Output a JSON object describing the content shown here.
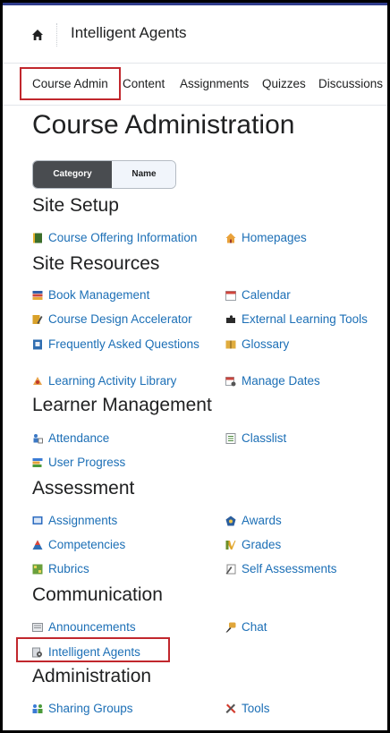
{
  "header": {
    "course_title": "Intelligent Agents",
    "home_icon": "home-icon"
  },
  "nav": [
    {
      "label": "Course Admin",
      "selected": true
    },
    {
      "label": "Content"
    },
    {
      "label": "Assignments"
    },
    {
      "label": "Quizzes"
    },
    {
      "label": "Discussions"
    }
  ],
  "page_title": "Course Administration",
  "view_toggle": {
    "category": "Category",
    "name": "Name",
    "selected": "Category"
  },
  "sections": [
    {
      "title": "Site Setup",
      "links": [
        {
          "label": "Course Offering Information",
          "icon": "book-icon"
        },
        {
          "label": "Homepages",
          "icon": "house-icon"
        }
      ]
    },
    {
      "title": "Site Resources",
      "links": [
        {
          "label": "Book Management",
          "icon": "books-icon"
        },
        {
          "label": "Calendar",
          "icon": "calendar-icon"
        },
        {
          "label": "Course Design Accelerator",
          "icon": "pencil-book-icon"
        },
        {
          "label": "External Learning Tools",
          "icon": "puzzle-icon"
        },
        {
          "label": "Frequently Asked Questions",
          "icon": "faq-book-icon"
        },
        {
          "label": "Glossary",
          "icon": "glossary-icon"
        },
        {
          "label": "Learning Activity Library",
          "icon": "library-icon"
        },
        {
          "label": "Manage Dates",
          "icon": "manage-dates-icon"
        }
      ]
    },
    {
      "title": "Learner Management",
      "links": [
        {
          "label": "Attendance",
          "icon": "attendance-icon"
        },
        {
          "label": "Classlist",
          "icon": "classlist-icon"
        },
        {
          "label": "User Progress",
          "icon": "progress-icon"
        }
      ]
    },
    {
      "title": "Assessment",
      "links": [
        {
          "label": "Assignments",
          "icon": "assignment-icon"
        },
        {
          "label": "Awards",
          "icon": "award-icon"
        },
        {
          "label": "Competencies",
          "icon": "competency-icon"
        },
        {
          "label": "Grades",
          "icon": "grades-icon"
        },
        {
          "label": "Rubrics",
          "icon": "rubric-icon"
        },
        {
          "label": "Self Assessments",
          "icon": "self-assessment-icon"
        }
      ]
    },
    {
      "title": "Communication",
      "links": [
        {
          "label": "Announcements",
          "icon": "announcement-icon"
        },
        {
          "label": "Chat",
          "icon": "chat-icon"
        },
        {
          "label": "Intelligent Agents",
          "icon": "gear-agent-icon",
          "highlighted": true
        }
      ]
    },
    {
      "title": "Administration",
      "links": [
        {
          "label": "Sharing Groups",
          "icon": "sharing-groups-icon"
        },
        {
          "label": "Tools",
          "icon": "tools-icon"
        }
      ]
    }
  ],
  "colors": {
    "link": "#1c6fb6",
    "highlight": "#c1272d",
    "accent": "#2f3c8c",
    "toggle_active": "#494c50"
  }
}
